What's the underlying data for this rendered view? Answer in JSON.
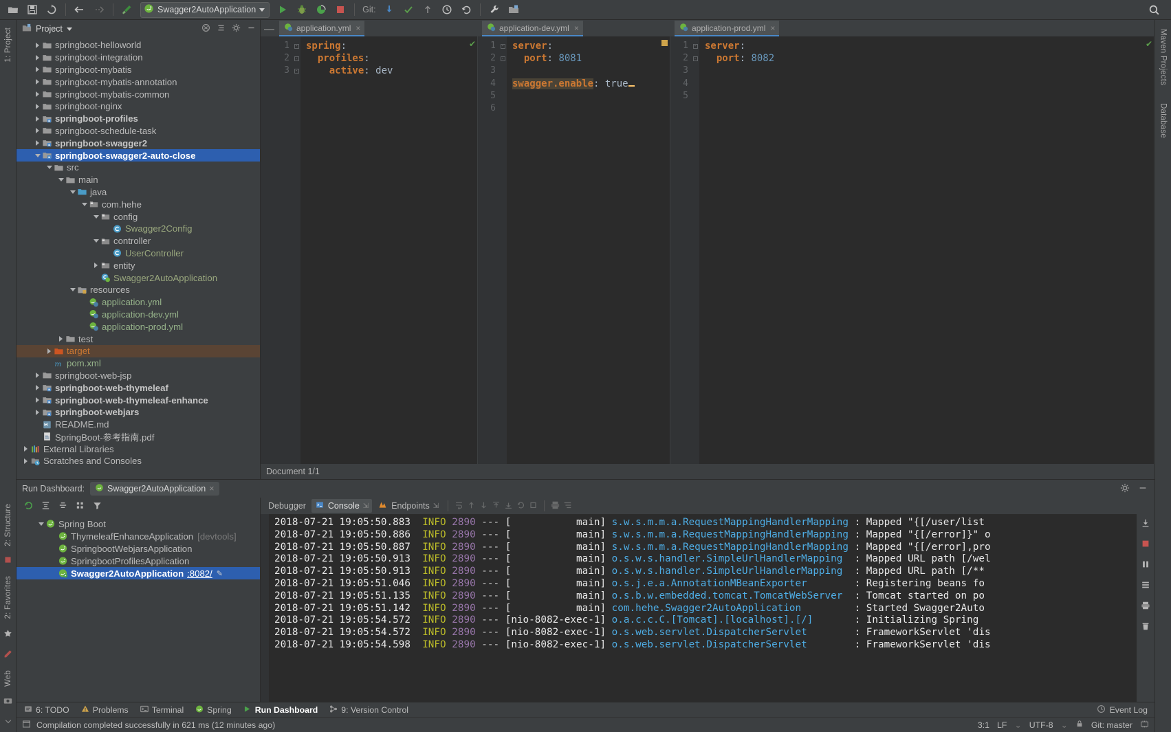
{
  "toolbar": {
    "icons": [
      "open-folder-icon",
      "save-all-icon",
      "sync-icon",
      "back-arrow-icon",
      "forward-arrow-icon",
      "build-hammer-icon"
    ],
    "run_config": {
      "label": "Swagger2AutoApplication",
      "icon": "spring-boot-icon",
      "dropdown": "chevron-down-icon"
    },
    "run_icon": "run-icon",
    "debug_icon": "debug-icon",
    "run-with-coverage_icon": "coverage-icon",
    "stop_icon": "stop-icon",
    "git_label": "Git:",
    "git_icons": [
      "update-project-icon",
      "commit-checkmark-icon",
      "push-icon",
      "history-clock-icon",
      "revert-icon"
    ],
    "wrench_icon": "settings-wrench-icon",
    "project-structure_icon": "project-structure-icon",
    "search_icon": "search-everywhere-icon"
  },
  "left_tool_window": {
    "tabs": [
      {
        "label": "1: Project"
      },
      {
        "label": "2: Structure"
      },
      {
        "label": "2: Favorites"
      },
      {
        "label": "Web"
      }
    ]
  },
  "right_tool_window": {
    "tabs": [
      {
        "label": "Maven Projects"
      },
      {
        "label": "Database"
      }
    ]
  },
  "project": {
    "title": "Project",
    "header_icons": [
      "collapse-all-icon",
      "flatten-packages-icon",
      "settings-gear-icon",
      "hide-icon"
    ],
    "items": [
      {
        "label": "springboot-helloworld",
        "indent": 1,
        "arrow": "right",
        "icon": "folder",
        "bold": false
      },
      {
        "label": "springboot-integration",
        "indent": 1,
        "arrow": "right",
        "icon": "folder",
        "bold": false
      },
      {
        "label": "springboot-mybatis",
        "indent": 1,
        "arrow": "right",
        "icon": "folder",
        "bold": false
      },
      {
        "label": "springboot-mybatis-annotation",
        "indent": 1,
        "arrow": "right",
        "icon": "folder",
        "bold": false
      },
      {
        "label": "springboot-mybatis-common",
        "indent": 1,
        "arrow": "right",
        "icon": "folder",
        "bold": false
      },
      {
        "label": "springboot-nginx",
        "indent": 1,
        "arrow": "right",
        "icon": "folder",
        "bold": false
      },
      {
        "label": "springboot-profiles",
        "indent": 1,
        "arrow": "right",
        "icon": "module",
        "bold": true
      },
      {
        "label": "springboot-schedule-task",
        "indent": 1,
        "arrow": "right",
        "icon": "folder",
        "bold": false
      },
      {
        "label": "springboot-swagger2",
        "indent": 1,
        "arrow": "right",
        "icon": "module",
        "bold": true
      },
      {
        "label": "springboot-swagger2-auto-close",
        "indent": 1,
        "arrow": "down",
        "icon": "module",
        "bold": true,
        "selected": true
      },
      {
        "label": "src",
        "indent": 2,
        "arrow": "down",
        "icon": "folder",
        "bold": false
      },
      {
        "label": "main",
        "indent": 3,
        "arrow": "down",
        "icon": "folder",
        "bold": false
      },
      {
        "label": "java",
        "indent": 4,
        "arrow": "down",
        "icon": "source-folder",
        "bold": false
      },
      {
        "label": "com.hehe",
        "indent": 5,
        "arrow": "down",
        "icon": "package",
        "bold": false
      },
      {
        "label": "config",
        "indent": 6,
        "arrow": "down",
        "icon": "package",
        "bold": false
      },
      {
        "label": "Swagger2Config",
        "indent": 7,
        "arrow": "none",
        "icon": "java-class",
        "bold": false,
        "color": "greenlt"
      },
      {
        "label": "controller",
        "indent": 6,
        "arrow": "down",
        "icon": "package",
        "bold": false
      },
      {
        "label": "UserController",
        "indent": 7,
        "arrow": "none",
        "icon": "java-class",
        "bold": false,
        "color": "greenlt"
      },
      {
        "label": "entity",
        "indent": 6,
        "arrow": "right",
        "icon": "package",
        "bold": false
      },
      {
        "label": "Swagger2AutoApplication",
        "indent": 6,
        "arrow": "none",
        "icon": "spring-class",
        "bold": false,
        "color": "greenlt"
      },
      {
        "label": "resources",
        "indent": 4,
        "arrow": "down",
        "icon": "resource-folder",
        "bold": false
      },
      {
        "label": "application.yml",
        "indent": 5,
        "arrow": "none",
        "icon": "spring-yml",
        "bold": false,
        "color": "green"
      },
      {
        "label": "application-dev.yml",
        "indent": 5,
        "arrow": "none",
        "icon": "spring-yml",
        "bold": false,
        "color": "green"
      },
      {
        "label": "application-prod.yml",
        "indent": 5,
        "arrow": "none",
        "icon": "spring-yml",
        "bold": false,
        "color": "green"
      },
      {
        "label": "test",
        "indent": 3,
        "arrow": "right",
        "icon": "folder",
        "bold": false
      },
      {
        "label": "target",
        "indent": 2,
        "arrow": "right",
        "icon": "excluded-folder",
        "bold": false,
        "color": "orange",
        "highlight": true
      },
      {
        "label": "pom.xml",
        "indent": 2,
        "arrow": "none",
        "icon": "maven-pom",
        "bold": false,
        "color": "green"
      },
      {
        "label": "springboot-web-jsp",
        "indent": 1,
        "arrow": "right",
        "icon": "folder",
        "bold": false
      },
      {
        "label": "springboot-web-thymeleaf",
        "indent": 1,
        "arrow": "right",
        "icon": "module",
        "bold": true
      },
      {
        "label": "springboot-web-thymeleaf-enhance",
        "indent": 1,
        "arrow": "right",
        "icon": "module",
        "bold": true
      },
      {
        "label": "springboot-webjars",
        "indent": 1,
        "arrow": "right",
        "icon": "module",
        "bold": true
      },
      {
        "label": "README.md",
        "indent": 1,
        "arrow": "none",
        "icon": "markdown-file",
        "bold": false
      },
      {
        "label": "SpringBoot-参考指南.pdf",
        "indent": 1,
        "arrow": "none",
        "icon": "pdf-file",
        "bold": false
      },
      {
        "label": "External Libraries",
        "indent": 0,
        "arrow": "right",
        "icon": "libraries",
        "bold": false
      },
      {
        "label": "Scratches and Consoles",
        "indent": 0,
        "arrow": "right",
        "icon": "scratches",
        "bold": false
      }
    ]
  },
  "editor": {
    "document_status": "Document 1/1",
    "panes": [
      {
        "tab": {
          "label": "application.yml",
          "icon": "spring-yml",
          "close": "×"
        },
        "line_numbers": [
          "1",
          "2",
          "3"
        ],
        "lines": [
          {
            "parts": [
              {
                "t": "spring",
                "c": "key"
              },
              {
                "t": ":",
                "c": "plain"
              }
            ]
          },
          {
            "parts": [
              {
                "t": "  profiles",
                "c": "key"
              },
              {
                "t": ":",
                "c": "plain"
              }
            ]
          },
          {
            "parts": [
              {
                "t": "    active",
                "c": "key"
              },
              {
                "t": ": ",
                "c": "plain"
              },
              {
                "t": "dev",
                "c": "val"
              }
            ]
          }
        ],
        "marker": "ok-check"
      },
      {
        "tab": {
          "label": "application-dev.yml",
          "icon": "spring-yml",
          "close": "×"
        },
        "line_numbers": [
          "1",
          "2",
          "3",
          "4",
          "5",
          "6"
        ],
        "lines": [
          {
            "parts": [
              {
                "t": "server",
                "c": "key"
              },
              {
                "t": ":",
                "c": "plain"
              }
            ]
          },
          {
            "parts": [
              {
                "t": "  port",
                "c": "key"
              },
              {
                "t": ": ",
                "c": "plain"
              },
              {
                "t": "8081",
                "c": "num"
              }
            ]
          },
          {
            "parts": []
          },
          {
            "parts": [
              {
                "t": "swagger.enable",
                "c": "hlkey"
              },
              {
                "t": ": ",
                "c": "plain"
              },
              {
                "t": "true",
                "c": "val"
              },
              {
                "t": "CARET",
                "c": "caret"
              }
            ]
          },
          {
            "parts": []
          },
          {
            "parts": []
          }
        ],
        "marker": "warn-square"
      },
      {
        "tab": {
          "label": "application-prod.yml",
          "icon": "spring-yml",
          "close": "×"
        },
        "line_numbers": [
          "1",
          "2",
          "3",
          "4",
          "5"
        ],
        "lines": [
          {
            "parts": [
              {
                "t": "server",
                "c": "key"
              },
              {
                "t": ":",
                "c": "plain"
              }
            ]
          },
          {
            "parts": [
              {
                "t": "  port",
                "c": "key"
              },
              {
                "t": ": ",
                "c": "plain"
              },
              {
                "t": "8082",
                "c": "num"
              }
            ]
          },
          {
            "parts": []
          },
          {
            "parts": []
          },
          {
            "parts": []
          }
        ],
        "marker": "ok-check"
      }
    ]
  },
  "run_dashboard": {
    "header_label": "Run Dashboard:",
    "active_tab": {
      "label": "Swagger2AutoApplication",
      "icon": "spring-boot-icon",
      "close": "×"
    },
    "header_icons": [
      "settings-gear-icon",
      "hide-icon"
    ],
    "toolbar_icons": [
      "rerun-icon",
      "expand-all-icon",
      "collapse-all-icon",
      "group-icon",
      "filter-icon"
    ],
    "tree": [
      {
        "label": "Spring Boot",
        "indent": 0,
        "arrow": "down",
        "icon": "spring-boot-icon",
        "bold": false
      },
      {
        "label": "ThymeleafEnhanceApplication",
        "indent": 1,
        "arrow": "none",
        "icon": "spring-boot-icon",
        "suffix": "[devtools]"
      },
      {
        "label": "SpringbootWebjarsApplication",
        "indent": 1,
        "arrow": "none",
        "icon": "spring-boot-icon"
      },
      {
        "label": "SpringbootProfilesApplication",
        "indent": 1,
        "arrow": "none",
        "icon": "spring-boot-icon"
      },
      {
        "label": "Swagger2AutoApplication",
        "indent": 1,
        "arrow": "none",
        "icon": "spring-boot-running-icon",
        "port": ":8082/",
        "selected": true,
        "bold": true
      }
    ],
    "console_tabs": [
      {
        "label": "Debugger",
        "icon": "debugger-icon",
        "active": false,
        "pin": false
      },
      {
        "label": "Console",
        "icon": "console-icon",
        "active": true,
        "pin": true
      },
      {
        "label": "Endpoints",
        "icon": "endpoints-icon",
        "active": false,
        "pin": true
      }
    ],
    "console_toolbar_icons": [
      "soft-wrap-icon",
      "scroll-up-icon",
      "scroll-down-icon",
      "step-up-icon",
      "step-down-icon",
      "rerun-icon",
      "stop-icon",
      "print-icon",
      "clear-all-icon"
    ],
    "console_sidebar_icons": [
      "scroll-to-end-icon",
      "stop-icon",
      "pause-icon",
      "thread-dump-icon",
      "print-icon",
      "trash-icon"
    ],
    "console_lines": [
      {
        "ts": "2018-07-21 19:05:50.883",
        "level": "INFO",
        "pid": "2890",
        "thread": "main",
        "logger": "s.w.s.m.m.a.RequestMappingHandlerMapping",
        "msg": "Mapped \"{[/user/list"
      },
      {
        "ts": "2018-07-21 19:05:50.886",
        "level": "INFO",
        "pid": "2890",
        "thread": "main",
        "logger": "s.w.s.m.m.a.RequestMappingHandlerMapping",
        "msg": "Mapped \"{[/error]}\" o"
      },
      {
        "ts": "2018-07-21 19:05:50.887",
        "level": "INFO",
        "pid": "2890",
        "thread": "main",
        "logger": "s.w.s.m.m.a.RequestMappingHandlerMapping",
        "msg": "Mapped \"{[/error],pro"
      },
      {
        "ts": "2018-07-21 19:05:50.913",
        "level": "INFO",
        "pid": "2890",
        "thread": "main",
        "logger": "o.s.w.s.handler.SimpleUrlHandlerMapping",
        "msg": "Mapped URL path [/wel"
      },
      {
        "ts": "2018-07-21 19:05:50.913",
        "level": "INFO",
        "pid": "2890",
        "thread": "main",
        "logger": "o.s.w.s.handler.SimpleUrlHandlerMapping",
        "msg": "Mapped URL path [/**"
      },
      {
        "ts": "2018-07-21 19:05:51.046",
        "level": "INFO",
        "pid": "2890",
        "thread": "main",
        "logger": "o.s.j.e.a.AnnotationMBeanExporter",
        "msg": "Registering beans fo"
      },
      {
        "ts": "2018-07-21 19:05:51.135",
        "level": "INFO",
        "pid": "2890",
        "thread": "main",
        "logger": "o.s.b.w.embedded.tomcat.TomcatWebServer",
        "msg": "Tomcat started on po"
      },
      {
        "ts": "2018-07-21 19:05:51.142",
        "level": "INFO",
        "pid": "2890",
        "thread": "main",
        "logger": "com.hehe.Swagger2AutoApplication",
        "msg": "Started Swagger2Auto"
      },
      {
        "ts": "2018-07-21 19:05:54.572",
        "level": "INFO",
        "pid": "2890",
        "thread": "nio-8082-exec-1",
        "logger": "o.a.c.c.C.[Tomcat].[localhost].[/]",
        "msg": "Initializing Spring "
      },
      {
        "ts": "2018-07-21 19:05:54.572",
        "level": "INFO",
        "pid": "2890",
        "thread": "nio-8082-exec-1",
        "logger": "o.s.web.servlet.DispatcherServlet",
        "msg": "FrameworkServlet 'dis"
      },
      {
        "ts": "2018-07-21 19:05:54.598",
        "level": "INFO",
        "pid": "2890",
        "thread": "nio-8082-exec-1",
        "logger": "o.s.web.servlet.DispatcherServlet",
        "msg": "FrameworkServlet 'dis"
      }
    ]
  },
  "tool_strip": {
    "items": [
      {
        "label": "6: TODO",
        "icon": "todo-icon",
        "active": false
      },
      {
        "label": "Problems",
        "icon": "problems-icon",
        "active": false
      },
      {
        "label": "Terminal",
        "icon": "terminal-icon",
        "active": false
      },
      {
        "label": "Spring",
        "icon": "spring-icon",
        "active": false
      },
      {
        "label": "Run Dashboard",
        "icon": "run-dashboard-icon",
        "active": true
      },
      {
        "label": "9: Version Control",
        "icon": "version-control-icon",
        "active": false
      }
    ],
    "event_log": {
      "label": "Event Log",
      "icon": "event-log-icon"
    }
  },
  "status_bar": {
    "message": "Compilation completed successfully in 621 ms (12 minutes ago)",
    "caret": "3:1",
    "line_separator": "LF",
    "encoding": "UTF-8",
    "branch": "Git: master",
    "lock_icon": "lock-icon",
    "memory_icon": "memory-icon"
  }
}
